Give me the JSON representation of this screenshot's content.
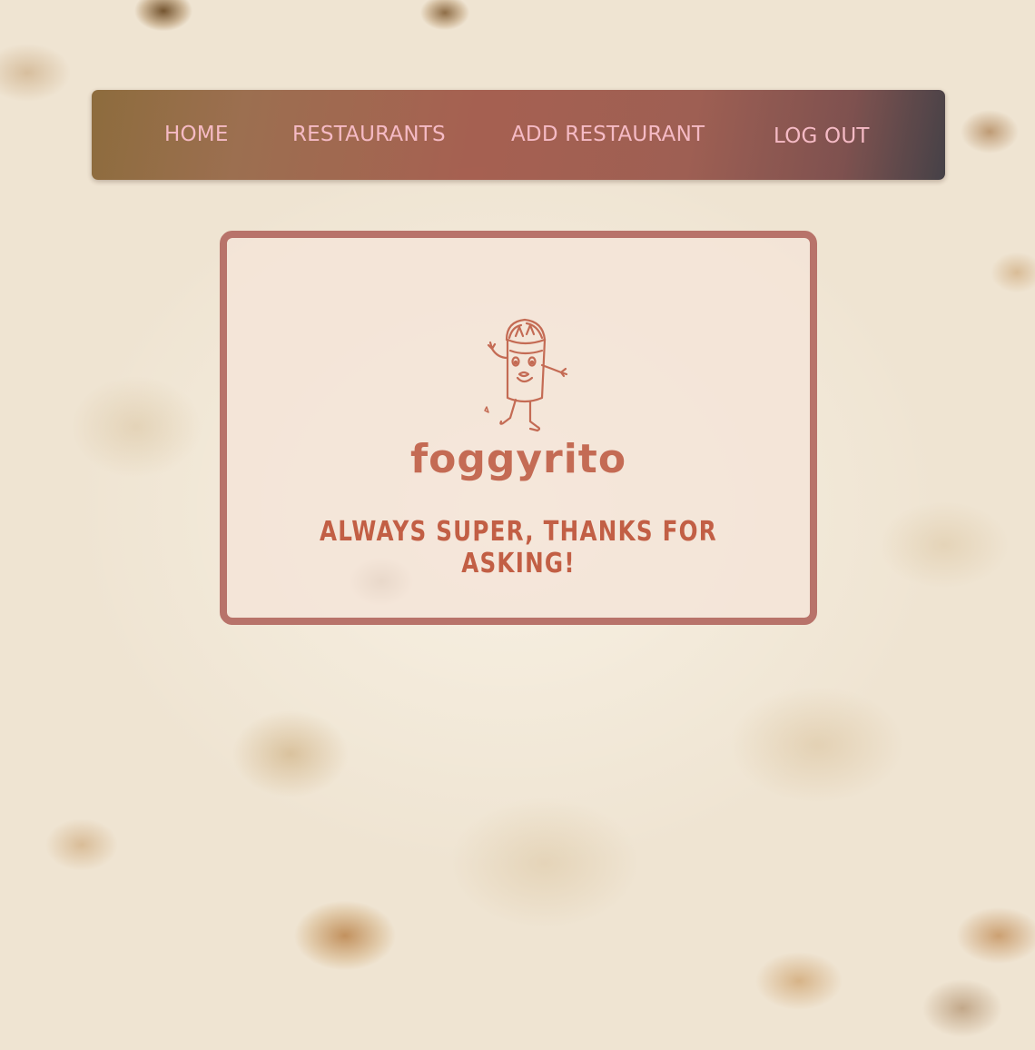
{
  "nav": {
    "home_label": "HOME",
    "restaurants_label": "RESTAURANTS",
    "add_restaurant_label": "ADD RESTAURANT",
    "logout_label": "LOG OUT"
  },
  "hero": {
    "logo_icon": "burrito-mascot-icon",
    "brand_name": "foggyrito",
    "tagline": "Always super, thanks for asking!"
  },
  "colors": {
    "nav_text": "#f6b9c5",
    "brand": "#c46b54",
    "card_border": "#b8736a"
  }
}
